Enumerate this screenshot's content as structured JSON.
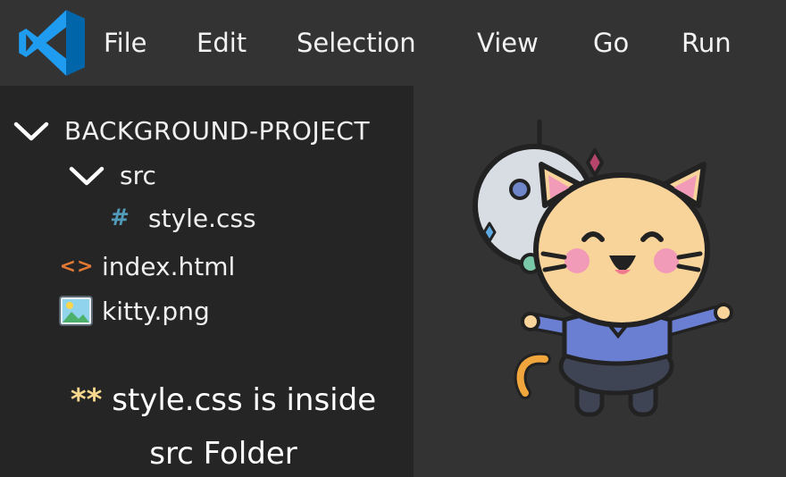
{
  "menu": {
    "items": [
      "File",
      "Edit",
      "Selection",
      "View",
      "Go",
      "Run"
    ]
  },
  "explorer": {
    "project_name": "BACKGROUND-PROJECT",
    "folder_src": "src",
    "file_style": "style.css",
    "file_index": "index.html",
    "file_kitty": "kitty.png",
    "icons": {
      "css": "#",
      "html": "<>"
    }
  },
  "note": {
    "stars": "**",
    "line1": "style.css is inside",
    "line2": "src Folder"
  },
  "colors": {
    "menubar_bg": "#333333",
    "explorer_bg": "#252526",
    "css_icon": "#519aba",
    "html_icon": "#e37933",
    "note_stars": "#f7d78e",
    "vscode_blue": "#23a8f2"
  }
}
